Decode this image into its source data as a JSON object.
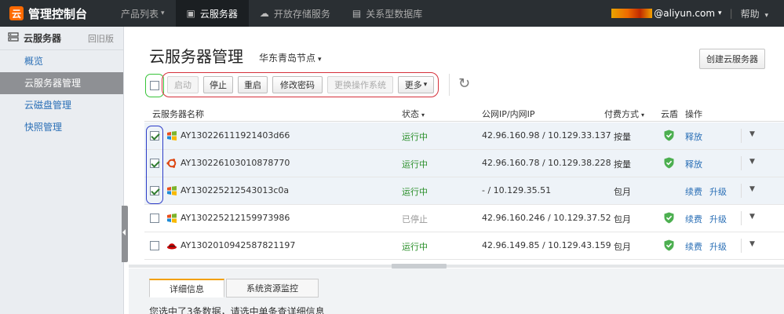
{
  "app": {
    "logo_glyph": "云",
    "logo_text": "管理控制台",
    "nav": [
      {
        "label": "产品列表",
        "caret": "▾",
        "icon": ""
      },
      {
        "label": "云服务器",
        "icon": "server-icon",
        "glyph": "▣"
      },
      {
        "label": "开放存储服务",
        "icon": "cloud-icon",
        "glyph": "☁"
      },
      {
        "label": "关系型数据库",
        "icon": "database-icon",
        "glyph": "▤"
      }
    ],
    "user_suffix": "@aliyun.com",
    "user_caret": "▾",
    "separator": "|",
    "help": "帮助",
    "help_caret": "▾"
  },
  "sidebar": {
    "header_title": "云服务器",
    "header_icon": "server-icon",
    "old_version": "回旧版",
    "items": [
      {
        "label": "概览"
      },
      {
        "label": "云服务器管理",
        "active": true
      },
      {
        "label": "云磁盘管理"
      },
      {
        "label": "快照管理"
      }
    ]
  },
  "main": {
    "title": "云服务器管理",
    "region": "华东青岛节点",
    "create_button": "创建云服务器",
    "toolbar": {
      "start": "启动",
      "stop": "停止",
      "restart": "重启",
      "change_password": "修改密码",
      "change_os": "更换操作系统",
      "more": "更多",
      "more_caret": "▾",
      "refresh_glyph": "↻"
    },
    "table": {
      "headers": {
        "name": "云服务器名称",
        "status": "状态",
        "ip": "公网IP/内网IP",
        "billing": "付费方式",
        "shield": "云盾",
        "actions": "操作"
      },
      "rows": [
        {
          "name": "AY130226111921403d66",
          "os": "windows",
          "status": "运行中",
          "ip": "42.96.160.98 / 10.129.33.137",
          "billing": "按量",
          "shield": true,
          "action1": "释放",
          "action2": ""
        },
        {
          "name": "AY130226103010878770",
          "os": "ubuntu",
          "status": "运行中",
          "ip": "42.96.160.78 / 10.129.38.228",
          "billing": "按量",
          "shield": true,
          "action1": "释放",
          "action2": ""
        },
        {
          "name": "AY130225212543013c0a",
          "os": "windows",
          "status": "运行中",
          "ip": "- / 10.129.35.51",
          "billing": "包月",
          "shield": false,
          "action1": "续费",
          "action2": "升级"
        },
        {
          "name": "AY130225212159973986",
          "os": "windows",
          "status": "已停止",
          "ip": "42.96.160.246 / 10.129.37.52",
          "billing": "包月",
          "shield": true,
          "action1": "续费",
          "action2": "升级"
        },
        {
          "name": "AY130201094258782119​7",
          "os": "redhat",
          "status": "运行中",
          "ip": "42.96.149.85 / 10.129.43.159",
          "billing": "包月",
          "shield": true,
          "action1": "续费",
          "action2": "升级"
        }
      ]
    },
    "bottom": {
      "tabs": [
        "详细信息",
        "系统资源监控"
      ],
      "info": "您选中了3条数据，请选中单条查详细信息"
    }
  },
  "colors": {
    "topbar": "#2a2f33",
    "accent": "#ff6a00",
    "link": "#2a6fb6",
    "running": "#2a8f2a",
    "selection_green": "#38c43a",
    "selection_red": "#d5303a",
    "selection_blue": "#2d3cc8"
  }
}
